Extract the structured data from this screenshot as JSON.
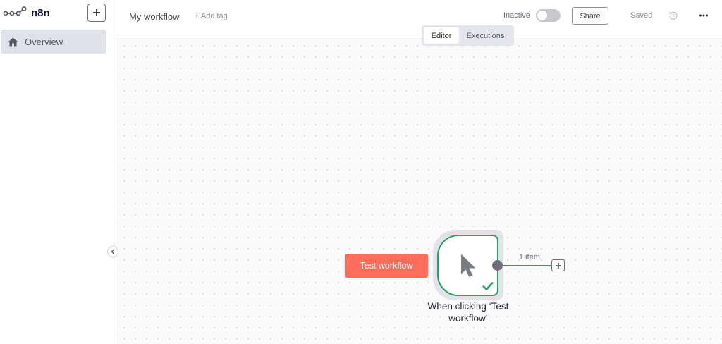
{
  "app": {
    "name": "n8n"
  },
  "sidebar": {
    "items": [
      {
        "label": "Overview",
        "icon": "home-icon"
      }
    ]
  },
  "header": {
    "workflow_name": "My workflow",
    "add_tag": "+ Add tag",
    "status": "Inactive",
    "share_label": "Share",
    "saved_label": "Saved"
  },
  "tabs": [
    {
      "label": "Editor",
      "active": true
    },
    {
      "label": "Executions",
      "active": false
    }
  ],
  "canvas": {
    "test_button": "Test workflow",
    "node": {
      "title": "When clicking ‘Test workflow’",
      "icon": "pointer-icon",
      "status": "success"
    },
    "output_label": "1 item"
  },
  "colors": {
    "accent": "#ff6d5a",
    "success": "#27a061",
    "nav_active_bg": "#dfe2eb"
  }
}
